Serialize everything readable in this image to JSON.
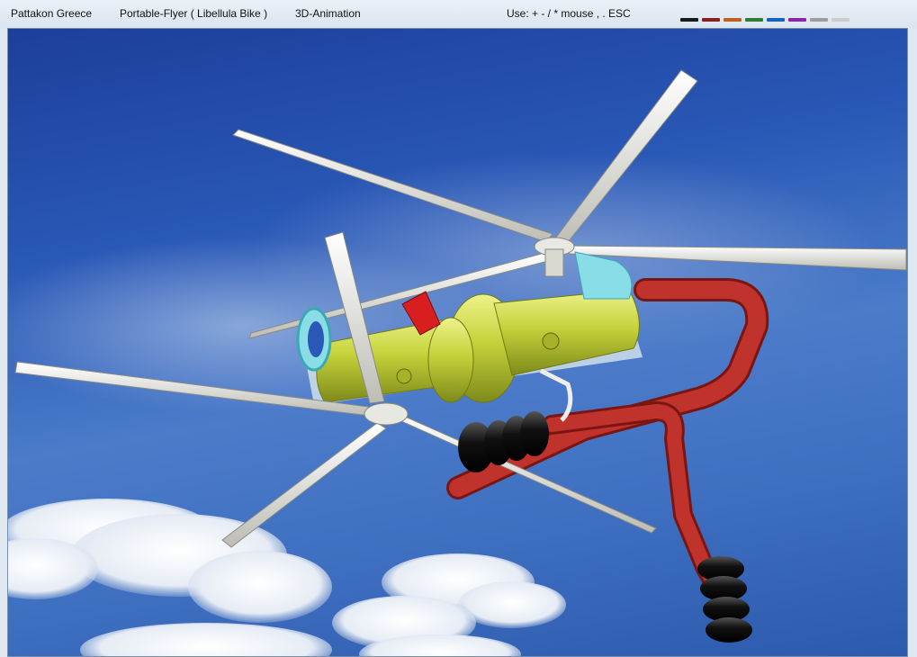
{
  "window": {
    "menu": [
      {
        "label": "Pattakon Greece"
      },
      {
        "label": "Portable-Flyer ( Libellula Bike )"
      },
      {
        "label": "3D-Animation"
      },
      {
        "label": "Use: + - / * mouse , .  ESC"
      }
    ]
  },
  "palette": [
    "#1a1a1a",
    "#8b1e1e",
    "#c06020",
    "#2e7d32",
    "#1565c0",
    "#8e24aa",
    "#9e9e9e",
    "#cccccc"
  ],
  "scene": {
    "model_colors": {
      "sky": "#2a58b6",
      "blade": "#eaeae4",
      "body": "#c5d23a",
      "intake": "#88dde6",
      "frame": "#c0322c",
      "grip": "#111111",
      "tip": "#d81e1e"
    }
  }
}
